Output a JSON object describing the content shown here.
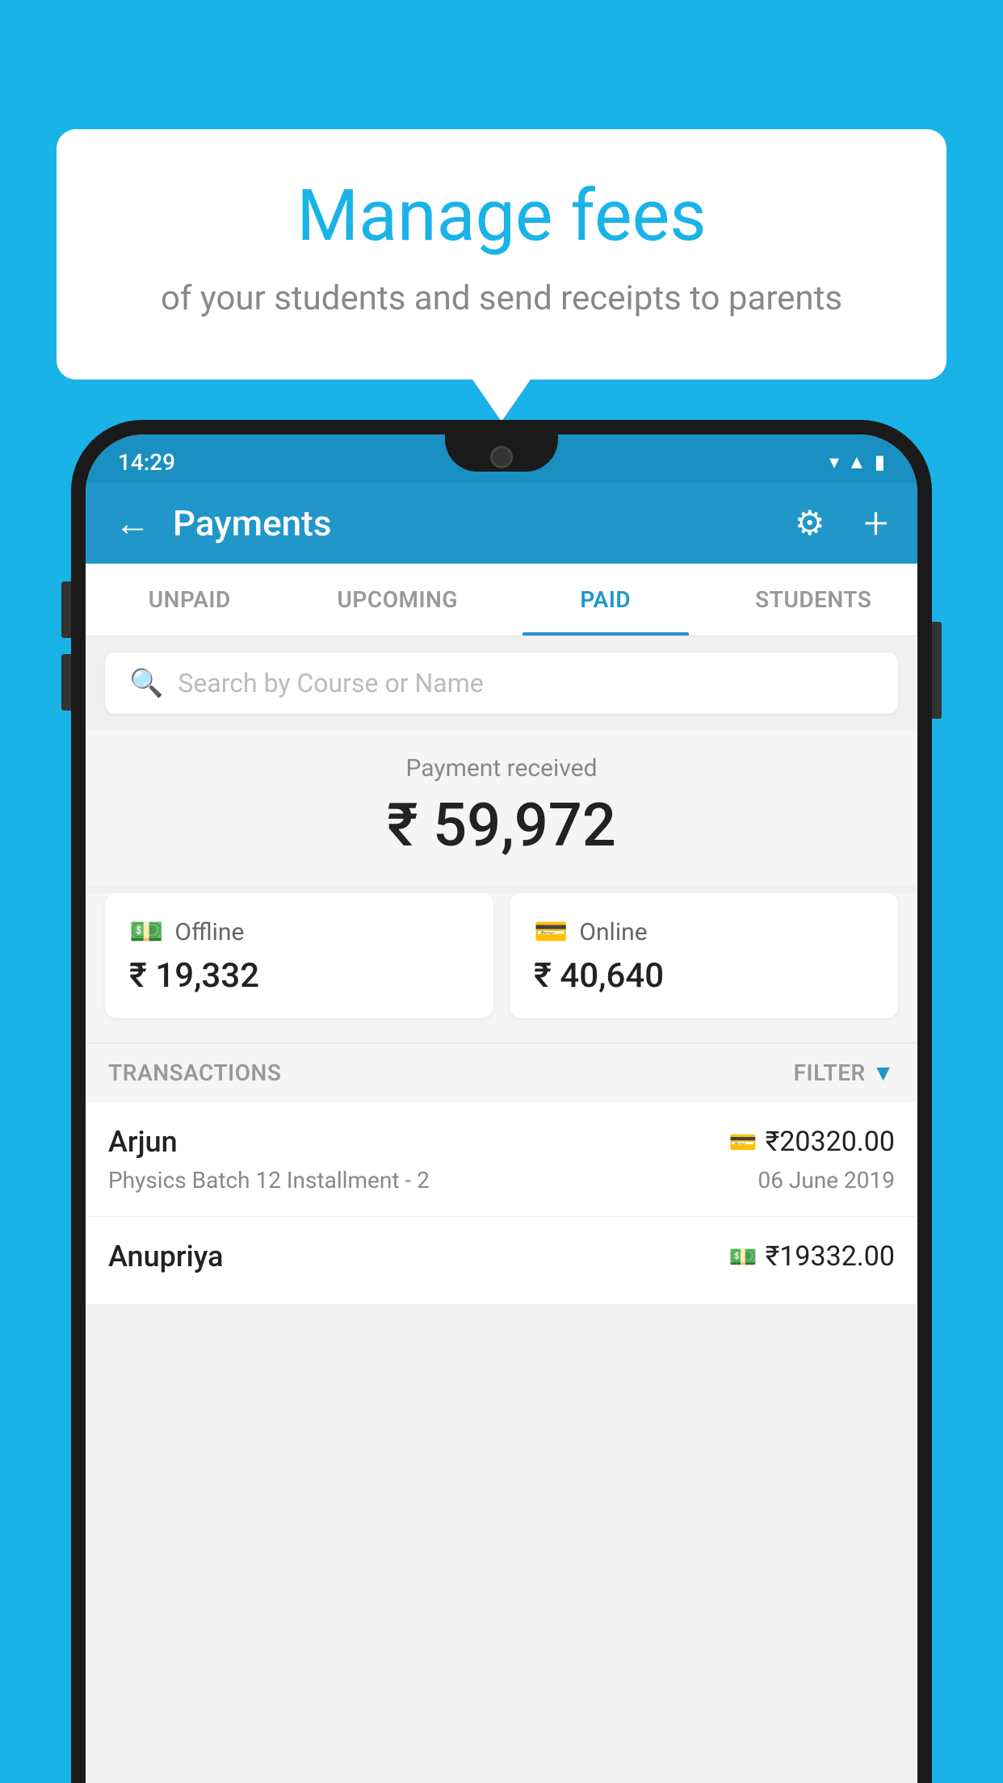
{
  "background_color": "#1ab3e8",
  "bubble": {
    "title": "Manage fees",
    "subtitle": "of your students and send receipts to parents"
  },
  "status_bar": {
    "time": "14:29",
    "icons": [
      "wifi",
      "signal",
      "battery"
    ]
  },
  "header": {
    "back_label": "←",
    "title": "Payments",
    "gear_label": "⚙",
    "plus_label": "+"
  },
  "tabs": [
    {
      "label": "UNPAID",
      "active": false
    },
    {
      "label": "UPCOMING",
      "active": false
    },
    {
      "label": "PAID",
      "active": true
    },
    {
      "label": "STUDENTS",
      "active": false
    }
  ],
  "search": {
    "placeholder": "Search by Course or Name"
  },
  "payment_summary": {
    "label": "Payment received",
    "amount": "₹ 59,972",
    "offline": {
      "label": "Offline",
      "amount": "₹ 19,332"
    },
    "online": {
      "label": "Online",
      "amount": "₹ 40,640"
    }
  },
  "transactions_section": {
    "label": "TRANSACTIONS",
    "filter_label": "FILTER"
  },
  "transactions": [
    {
      "name": "Arjun",
      "course": "Physics Batch 12 Installment - 2",
      "amount": "₹20320.00",
      "date": "06 June 2019",
      "payment_type": "card"
    },
    {
      "name": "Anupriya",
      "course": "",
      "amount": "₹19332.00",
      "date": "",
      "payment_type": "offline"
    }
  ]
}
